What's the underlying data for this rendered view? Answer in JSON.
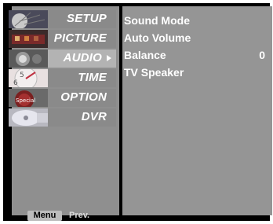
{
  "sidebar": {
    "items": [
      {
        "label": "SETUP",
        "icon": "satellite-dish-icon"
      },
      {
        "label": "PICTURE",
        "icon": "film-reel-icon"
      },
      {
        "label": "AUDIO",
        "icon": "speaker-icon",
        "selected": true
      },
      {
        "label": "TIME",
        "icon": "clock-icon"
      },
      {
        "label": "OPTION",
        "icon": "special-ball-icon"
      },
      {
        "label": "DVR",
        "icon": "disc-icon"
      }
    ]
  },
  "audio_menu": {
    "items": [
      {
        "label": "Sound Mode",
        "value": ""
      },
      {
        "label": "Auto Volume",
        "value": ""
      },
      {
        "label": "Balance",
        "value": "0"
      },
      {
        "label": "TV Speaker",
        "value": ""
      }
    ]
  },
  "footer": {
    "menu_label": "Menu",
    "prev_label": "Prev."
  },
  "colors": {
    "background": "#000000",
    "panel": "#8f8f8f",
    "selected": "#b3b3b3",
    "text": "#ffffff"
  }
}
